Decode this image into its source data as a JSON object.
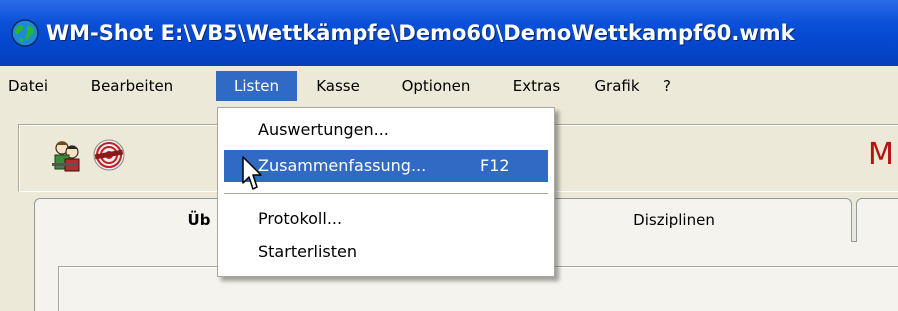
{
  "window": {
    "title": "WM-Shot E:\\VB5\\Wettkämpfe\\Demo60\\DemoWettkampf60.wmk",
    "icon": "globe-icon"
  },
  "menubar": {
    "items": [
      {
        "label": "Datei"
      },
      {
        "label": "Bearbeiten"
      },
      {
        "label": "Listen",
        "active": true
      },
      {
        "label": "Kasse"
      },
      {
        "label": "Optionen"
      },
      {
        "label": "Extras"
      },
      {
        "label": "Grafik"
      },
      {
        "label": "?"
      }
    ]
  },
  "dropdown": {
    "items": [
      {
        "label": "Auswertungen...",
        "shortcut": ""
      },
      {
        "label": "Zusammenfassung...",
        "shortcut": "F12",
        "highlighted": true
      },
      {
        "label": "Protokoll...",
        "shortcut": ""
      },
      {
        "label": "Starterlisten",
        "shortcut": ""
      }
    ]
  },
  "toolbar": {
    "icons": [
      "shooters-icon",
      "target-icon"
    ],
    "title_fragment": "M"
  },
  "tabs": [
    {
      "label": "Üb"
    },
    {
      "label": "Disziplinen"
    }
  ],
  "colors": {
    "titlebar": "#0a50d8",
    "menu_highlight": "#316ac5",
    "title_red": "#b81010"
  }
}
